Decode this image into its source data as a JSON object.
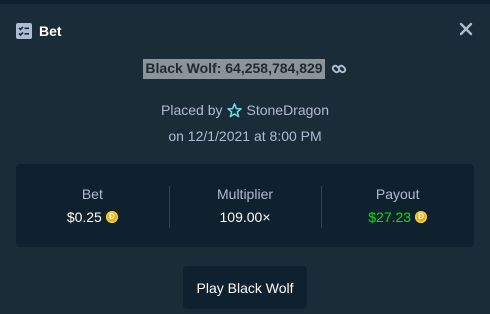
{
  "header": {
    "title": "Bet",
    "icon": "bet-list-icon"
  },
  "bet": {
    "game_id": "Black Wolf: 64,258,784,829",
    "placed_by_label": "Placed by",
    "username": "StoneDragon",
    "date_text": "on 12/1/2021 at 8:00 PM"
  },
  "stats": {
    "bet_label": "Bet",
    "bet_value": "$0.25",
    "multiplier_label": "Multiplier",
    "multiplier_value": "109.00×",
    "payout_label": "Payout",
    "payout_value": "$27.23"
  },
  "actions": {
    "play_label": "Play Black Wolf"
  },
  "colors": {
    "background": "#1a2c38",
    "card": "#0f212e",
    "accent_green": "#00e701",
    "coin": "#e7b000",
    "muted_text": "#b1bad3"
  }
}
